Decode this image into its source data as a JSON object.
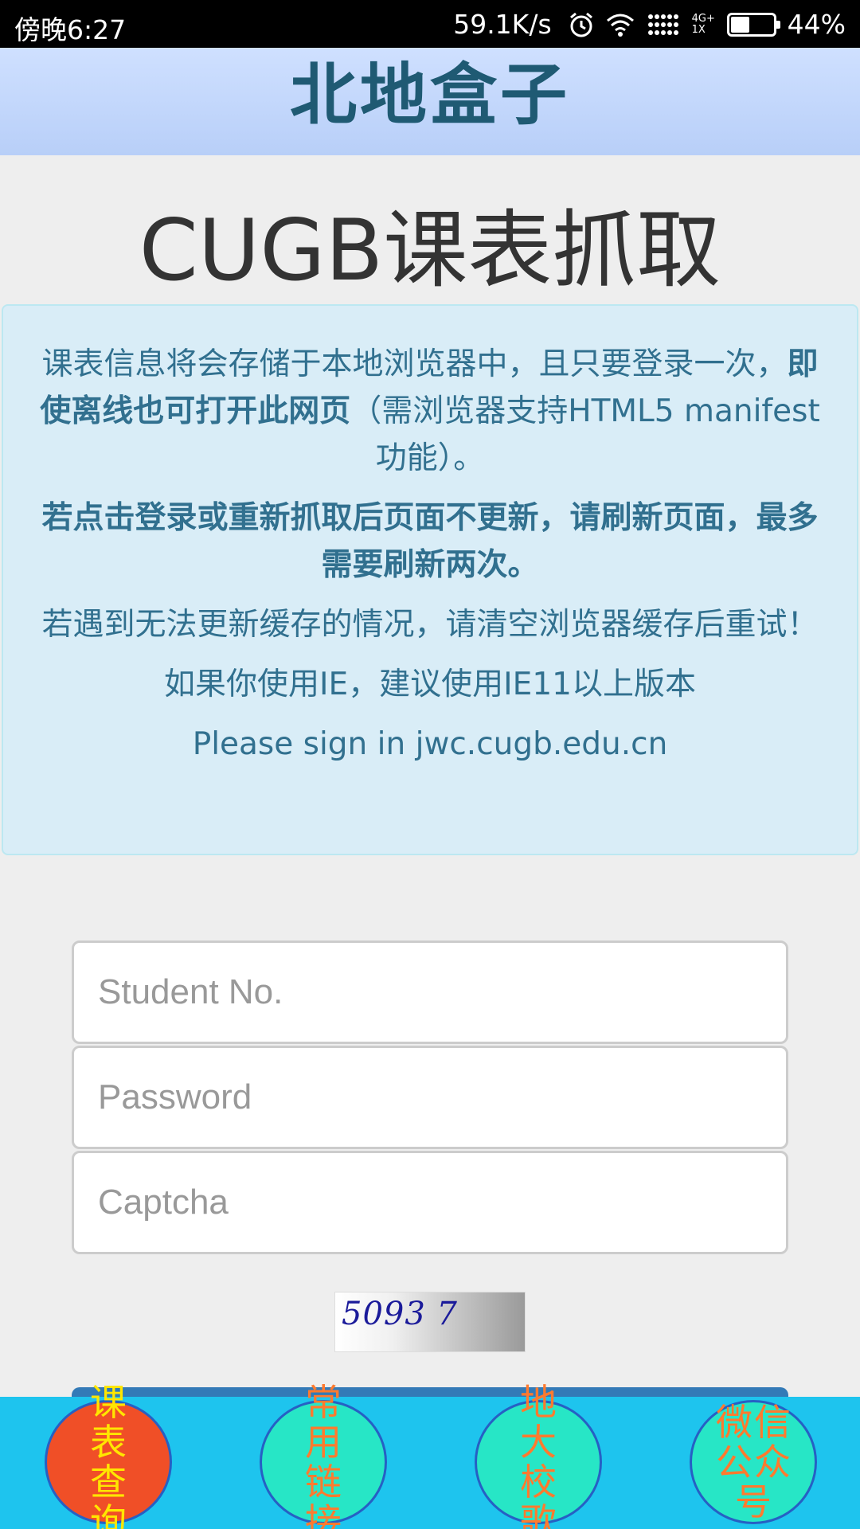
{
  "status_bar": {
    "time": "傍晚6:27",
    "net_speed": "59.1K/s",
    "network_type": "4G+",
    "sim_slot": "1X",
    "battery_percent": "44%",
    "battery_level": 0.44,
    "icons": [
      "alarm-icon",
      "wifi-icon",
      "signal-icon",
      "battery-icon"
    ]
  },
  "app_bar": {
    "title": "北地盒子"
  },
  "page_title": "CUGB课表抓取",
  "notice": {
    "p1_a": "课表信息将会存储于本地浏览器中，且只要登录一次，",
    "p1_bold": "即使离线也可打开此网页",
    "p1_b": "（需浏览器支持HTML5 manifest功能）。",
    "p2": "若点击登录或重新抓取后页面不更新，请刷新页面，最多需要刷新两次。",
    "p3": "若遇到无法更新缓存的情况，请清空浏览器缓存后重试！",
    "p4": "如果你使用IE，建议使用IE11以上版本",
    "p5": "Please sign in jwc.cugb.edu.cn"
  },
  "form": {
    "student_no_placeholder": "Student No.",
    "password_placeholder": "Password",
    "captcha_placeholder": "Captcha",
    "captcha_image_text": "5093 7"
  },
  "bottom_nav": [
    {
      "label": "课表查询",
      "bg": "#f04f27",
      "fg": "#ffe600"
    },
    {
      "label": "常用链接",
      "bg": "#27e6c6",
      "fg": "#ff7a2e"
    },
    {
      "label": "地大校歌",
      "bg": "#27e6c6",
      "fg": "#ff7a2e"
    },
    {
      "label": "微信公众号",
      "bg": "#27e6c6",
      "fg": "#ff7a2e"
    }
  ],
  "colors": {
    "app_bar_bg": "#c3d7fb",
    "app_bar_text": "#1f5a73",
    "notice_bg": "#d9edf7",
    "notice_text": "#31708f",
    "bottom_bar_bg": "#1ec4ee",
    "primary_button": "#337ab7"
  }
}
